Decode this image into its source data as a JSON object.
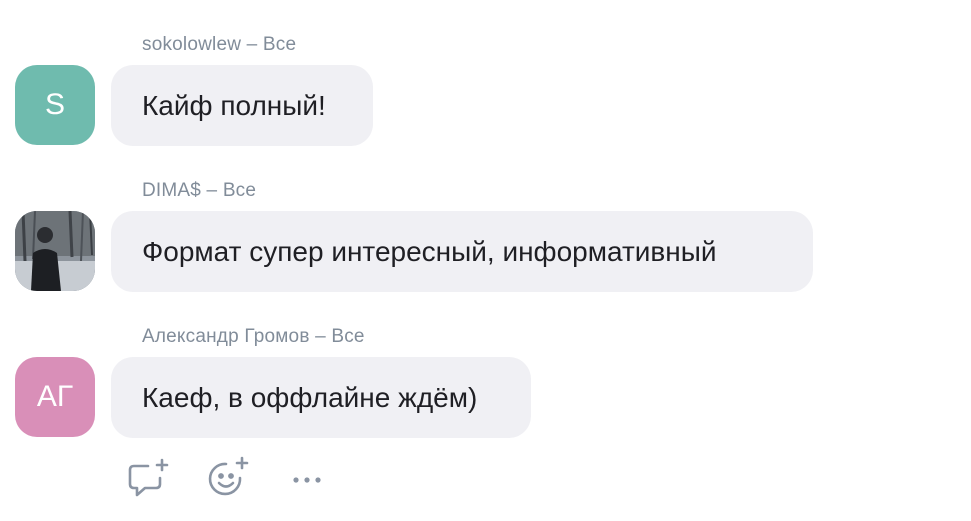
{
  "messages": [
    {
      "author": "sokolowlew",
      "audience": "Все",
      "avatar_initials": "S",
      "avatar_color": "#6fbbae",
      "text": "Кайф полный!"
    },
    {
      "author": "DIMA$",
      "audience": "Все",
      "avatar_initials": "",
      "avatar_color": "#7a8490",
      "avatar_icon": "user-photo",
      "text": "Формат супер интересный, информативный"
    },
    {
      "author": "Александр Громов",
      "audience": "Все",
      "avatar_initials": "АГ",
      "avatar_color": "#d98fb8",
      "text": "Каеф, в оффлайне ждём)"
    }
  ],
  "header_separator": " – ",
  "actions": {
    "reply_icon": "reply-add-icon",
    "react_icon": "add-reaction-icon",
    "more_icon": "more-dots-icon",
    "icon_color": "#8a94a3"
  }
}
